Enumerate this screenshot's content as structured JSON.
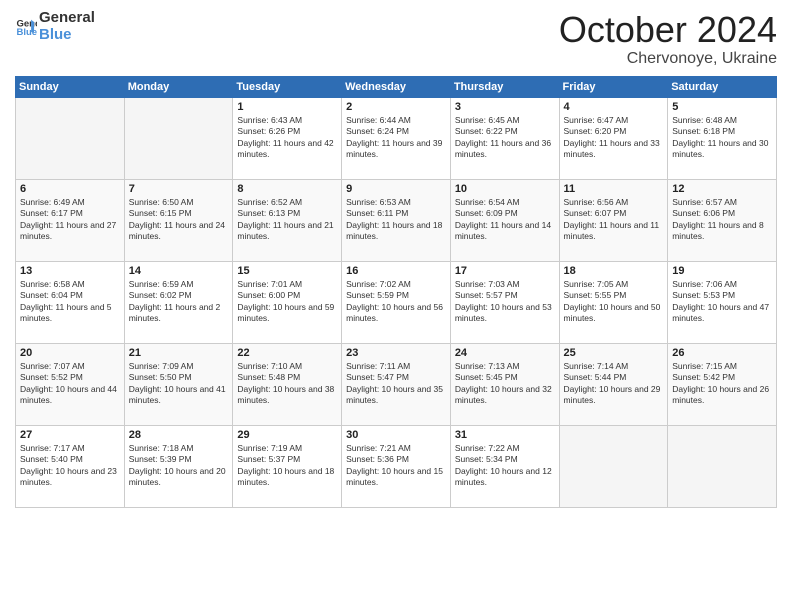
{
  "header": {
    "logo_line1": "General",
    "logo_line2": "Blue",
    "month": "October 2024",
    "location": "Chervonoye, Ukraine"
  },
  "days_of_week": [
    "Sunday",
    "Monday",
    "Tuesday",
    "Wednesday",
    "Thursday",
    "Friday",
    "Saturday"
  ],
  "weeks": [
    [
      {
        "num": "",
        "info": ""
      },
      {
        "num": "",
        "info": ""
      },
      {
        "num": "1",
        "info": "Sunrise: 6:43 AM\nSunset: 6:26 PM\nDaylight: 11 hours and 42 minutes."
      },
      {
        "num": "2",
        "info": "Sunrise: 6:44 AM\nSunset: 6:24 PM\nDaylight: 11 hours and 39 minutes."
      },
      {
        "num": "3",
        "info": "Sunrise: 6:45 AM\nSunset: 6:22 PM\nDaylight: 11 hours and 36 minutes."
      },
      {
        "num": "4",
        "info": "Sunrise: 6:47 AM\nSunset: 6:20 PM\nDaylight: 11 hours and 33 minutes."
      },
      {
        "num": "5",
        "info": "Sunrise: 6:48 AM\nSunset: 6:18 PM\nDaylight: 11 hours and 30 minutes."
      }
    ],
    [
      {
        "num": "6",
        "info": "Sunrise: 6:49 AM\nSunset: 6:17 PM\nDaylight: 11 hours and 27 minutes."
      },
      {
        "num": "7",
        "info": "Sunrise: 6:50 AM\nSunset: 6:15 PM\nDaylight: 11 hours and 24 minutes."
      },
      {
        "num": "8",
        "info": "Sunrise: 6:52 AM\nSunset: 6:13 PM\nDaylight: 11 hours and 21 minutes."
      },
      {
        "num": "9",
        "info": "Sunrise: 6:53 AM\nSunset: 6:11 PM\nDaylight: 11 hours and 18 minutes."
      },
      {
        "num": "10",
        "info": "Sunrise: 6:54 AM\nSunset: 6:09 PM\nDaylight: 11 hours and 14 minutes."
      },
      {
        "num": "11",
        "info": "Sunrise: 6:56 AM\nSunset: 6:07 PM\nDaylight: 11 hours and 11 minutes."
      },
      {
        "num": "12",
        "info": "Sunrise: 6:57 AM\nSunset: 6:06 PM\nDaylight: 11 hours and 8 minutes."
      }
    ],
    [
      {
        "num": "13",
        "info": "Sunrise: 6:58 AM\nSunset: 6:04 PM\nDaylight: 11 hours and 5 minutes."
      },
      {
        "num": "14",
        "info": "Sunrise: 6:59 AM\nSunset: 6:02 PM\nDaylight: 11 hours and 2 minutes."
      },
      {
        "num": "15",
        "info": "Sunrise: 7:01 AM\nSunset: 6:00 PM\nDaylight: 10 hours and 59 minutes."
      },
      {
        "num": "16",
        "info": "Sunrise: 7:02 AM\nSunset: 5:59 PM\nDaylight: 10 hours and 56 minutes."
      },
      {
        "num": "17",
        "info": "Sunrise: 7:03 AM\nSunset: 5:57 PM\nDaylight: 10 hours and 53 minutes."
      },
      {
        "num": "18",
        "info": "Sunrise: 7:05 AM\nSunset: 5:55 PM\nDaylight: 10 hours and 50 minutes."
      },
      {
        "num": "19",
        "info": "Sunrise: 7:06 AM\nSunset: 5:53 PM\nDaylight: 10 hours and 47 minutes."
      }
    ],
    [
      {
        "num": "20",
        "info": "Sunrise: 7:07 AM\nSunset: 5:52 PM\nDaylight: 10 hours and 44 minutes."
      },
      {
        "num": "21",
        "info": "Sunrise: 7:09 AM\nSunset: 5:50 PM\nDaylight: 10 hours and 41 minutes."
      },
      {
        "num": "22",
        "info": "Sunrise: 7:10 AM\nSunset: 5:48 PM\nDaylight: 10 hours and 38 minutes."
      },
      {
        "num": "23",
        "info": "Sunrise: 7:11 AM\nSunset: 5:47 PM\nDaylight: 10 hours and 35 minutes."
      },
      {
        "num": "24",
        "info": "Sunrise: 7:13 AM\nSunset: 5:45 PM\nDaylight: 10 hours and 32 minutes."
      },
      {
        "num": "25",
        "info": "Sunrise: 7:14 AM\nSunset: 5:44 PM\nDaylight: 10 hours and 29 minutes."
      },
      {
        "num": "26",
        "info": "Sunrise: 7:15 AM\nSunset: 5:42 PM\nDaylight: 10 hours and 26 minutes."
      }
    ],
    [
      {
        "num": "27",
        "info": "Sunrise: 7:17 AM\nSunset: 5:40 PM\nDaylight: 10 hours and 23 minutes."
      },
      {
        "num": "28",
        "info": "Sunrise: 7:18 AM\nSunset: 5:39 PM\nDaylight: 10 hours and 20 minutes."
      },
      {
        "num": "29",
        "info": "Sunrise: 7:19 AM\nSunset: 5:37 PM\nDaylight: 10 hours and 18 minutes."
      },
      {
        "num": "30",
        "info": "Sunrise: 7:21 AM\nSunset: 5:36 PM\nDaylight: 10 hours and 15 minutes."
      },
      {
        "num": "31",
        "info": "Sunrise: 7:22 AM\nSunset: 5:34 PM\nDaylight: 10 hours and 12 minutes."
      },
      {
        "num": "",
        "info": ""
      },
      {
        "num": "",
        "info": ""
      }
    ]
  ]
}
